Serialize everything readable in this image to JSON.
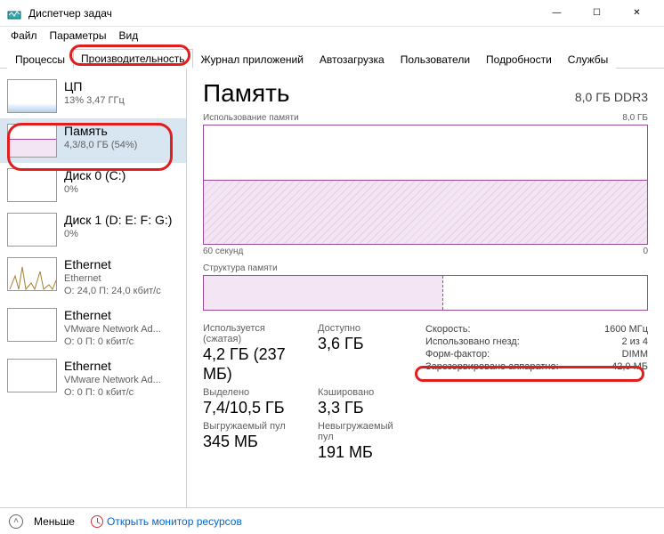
{
  "window": {
    "title": "Диспетчер задач",
    "min": "—",
    "max": "☐",
    "close": "✕"
  },
  "menu": [
    "Файл",
    "Параметры",
    "Вид"
  ],
  "tabs": [
    "Процессы",
    "Производительность",
    "Журнал приложений",
    "Автозагрузка",
    "Пользователи",
    "Подробности",
    "Службы"
  ],
  "sidebar": [
    {
      "name": "ЦП",
      "sub": "13%  3,47 ГГц"
    },
    {
      "name": "Память",
      "sub": "4,3/8,0 ГБ (54%)"
    },
    {
      "name": "Диск 0 (C:)",
      "sub": "0%"
    },
    {
      "name": "Диск 1 (D: E: F: G:)",
      "sub": "0%"
    },
    {
      "name": "Ethernet",
      "sub": "Ethernet",
      "sub2": "О: 24,0 П: 24,0 кбит/с"
    },
    {
      "name": "Ethernet",
      "sub": "VMware Network Ad...",
      "sub2": "О: 0 П: 0 кбит/с"
    },
    {
      "name": "Ethernet",
      "sub": "VMware Network Ad...",
      "sub2": "О: 0 П: 0 кбит/с"
    }
  ],
  "main": {
    "title": "Память",
    "hardware": "8,0 ГБ DDR3",
    "usage_label": "Использование памяти",
    "usage_max": "8,0 ГБ",
    "axis_left": "60 секунд",
    "axis_right": "0",
    "struct_label": "Структура памяти",
    "stats": {
      "inuse_label": "Используется (сжатая)",
      "inuse_value": "4,2 ГБ (237 МБ)",
      "avail_label": "Доступно",
      "avail_value": "3,6 ГБ",
      "committed_label": "Выделено",
      "committed_value": "7,4/10,5 ГБ",
      "cached_label": "Кэшировано",
      "cached_value": "3,3 ГБ",
      "paged_label": "Выгружаемый пул",
      "paged_value": "345 МБ",
      "nonpaged_label": "Невыгружаемый пул",
      "nonpaged_value": "191 МБ"
    },
    "hw": {
      "speed_label": "Скорость:",
      "speed_value": "1600 МГц",
      "slots_label": "Использовано гнезд:",
      "slots_value": "2 из 4",
      "form_label": "Форм-фактор:",
      "form_value": "DIMM",
      "reserved_label": "Зарезервировано аппаратно:",
      "reserved_value": "42,0 МБ"
    }
  },
  "footer": {
    "less": "Меньше",
    "monitor": "Открыть монитор ресурсов"
  },
  "chart_data": {
    "type": "area",
    "title": "Использование памяти",
    "ylabel": "ГБ",
    "ylim": [
      0,
      8.0
    ],
    "xlabel": "секунд",
    "xlim": [
      60,
      0
    ],
    "series": [
      {
        "name": "Используется",
        "value_gb": 4.3,
        "percent": 54
      }
    ]
  }
}
